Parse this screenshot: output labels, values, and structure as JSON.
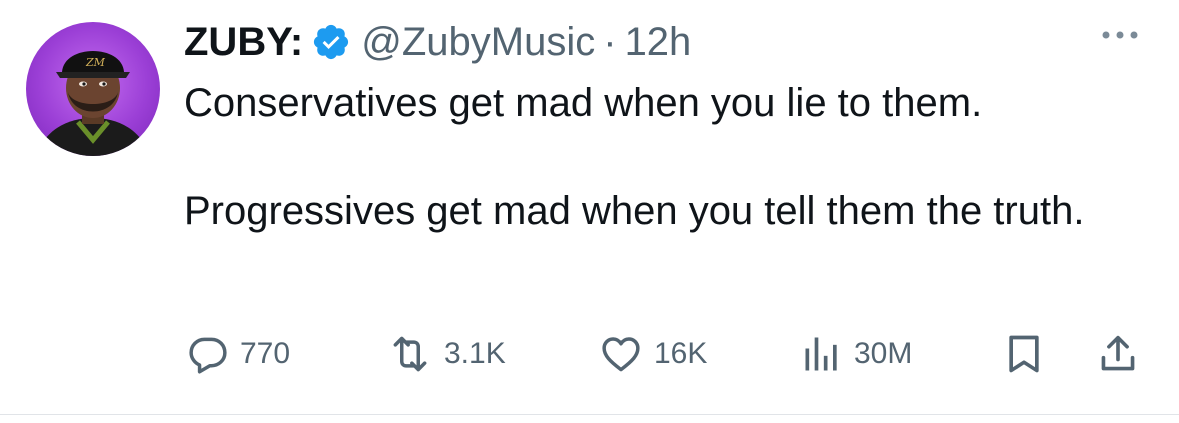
{
  "tweet": {
    "author": {
      "name": "ZUBY:",
      "handle": "@ZubyMusic",
      "verified_icon": "verified-badge-icon",
      "avatar_icon": "avatar"
    },
    "separator": "·",
    "timestamp": "12h",
    "more_icon": "more-options-icon",
    "text": "Conservatives get mad when you lie to them.\n\nProgressives get mad when you tell them the truth.",
    "actions": {
      "reply": {
        "icon": "reply-icon",
        "count": "770"
      },
      "retweet": {
        "icon": "retweet-icon",
        "count": "3.1K"
      },
      "like": {
        "icon": "heart-icon",
        "count": "16K"
      },
      "views": {
        "icon": "views-icon",
        "count": "30M"
      },
      "bookmark": {
        "icon": "bookmark-icon"
      },
      "share": {
        "icon": "share-icon"
      }
    },
    "colors": {
      "text": "#0f1419",
      "secondary": "#536471",
      "verified": "#1d9bf0",
      "avatar_bg": "#9b3fd6"
    }
  }
}
